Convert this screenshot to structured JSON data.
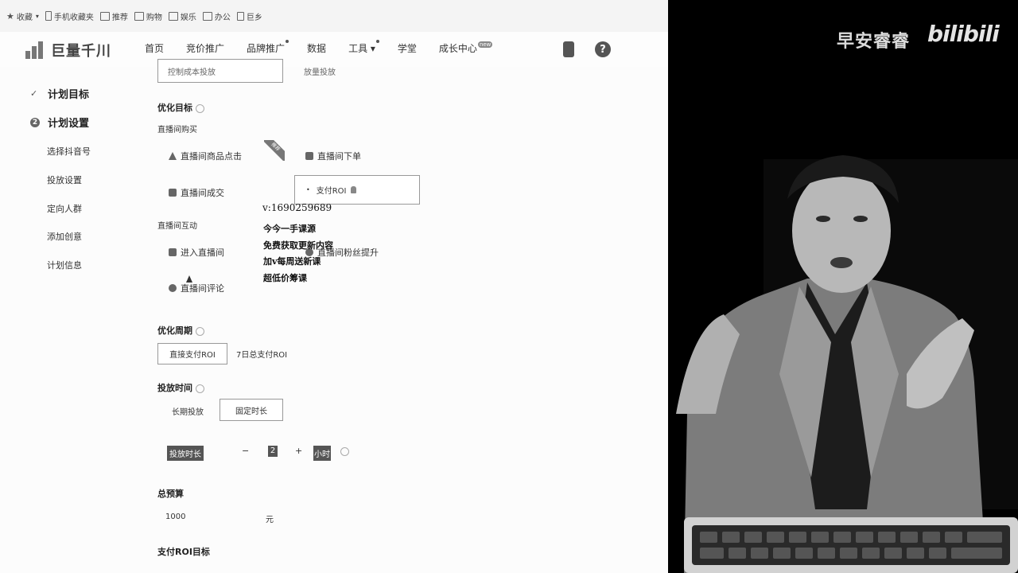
{
  "bookmarks": [
    {
      "label": "收藏",
      "icon": "star-icon"
    },
    {
      "label": "手机收藏夹",
      "icon": "phone-icon"
    },
    {
      "label": "推荐",
      "icon": "folder-icon"
    },
    {
      "label": "购物",
      "icon": "folder-icon"
    },
    {
      "label": "娱乐",
      "icon": "folder-icon"
    },
    {
      "label": "办公",
      "icon": "folder-icon"
    },
    {
      "label": "巨乡",
      "icon": "page-icon"
    }
  ],
  "header": {
    "logo_text": "巨量千川",
    "nav": [
      {
        "label": "首页"
      },
      {
        "label": "竞价推广"
      },
      {
        "label": "品牌推广",
        "dot": true
      },
      {
        "label": "数据"
      },
      {
        "label": "工具 ▾",
        "dot": true
      },
      {
        "label": "学堂"
      },
      {
        "label": "成长中心",
        "badge": "new"
      }
    ],
    "help_symbol": "?"
  },
  "sidebar": {
    "step1": {
      "mark": "✓",
      "label": "计划目标"
    },
    "step2": {
      "mark": "2",
      "label": "计划设置"
    },
    "items": [
      "选择抖音号",
      "投放设置",
      "定向人群",
      "添加创意",
      "计划信息"
    ]
  },
  "main": {
    "top_partial": {
      "left": "控制成本投放",
      "right": "放量投放"
    },
    "optimize_target": {
      "title": "优化目标",
      "live_purchase": "直播间购买",
      "options_purchase": [
        "直播间商品点击",
        "直播间下单",
        "直播间成交",
        "支付ROI"
      ],
      "rec_tag": "推荐",
      "live_interact": "直播间互动",
      "options_interact": [
        "进入直播间",
        "直播间粉丝提升",
        "直播间评论"
      ]
    },
    "optimize_period": {
      "title": "优化周期",
      "options": [
        "直接支付ROI",
        "7日总支付ROI"
      ]
    },
    "delivery_time": {
      "title": "投放时间",
      "options": [
        "长期投放",
        "固定时长"
      ],
      "duration_label": "投放时长",
      "minus": "−",
      "value": "2",
      "plus": "+",
      "unit": "小时"
    },
    "budget": {
      "title": "总预算",
      "value": "1000",
      "unit": "元"
    },
    "roi_target": {
      "title": "支付ROI目标"
    }
  },
  "overlay": {
    "lines": [
      "v:1690259689",
      "今今一手课源",
      "免费获取更新内容",
      "加v每周送新课",
      "超低价筹课"
    ]
  },
  "video": {
    "channel_name": "早安睿睿",
    "platform": "bilibili"
  }
}
